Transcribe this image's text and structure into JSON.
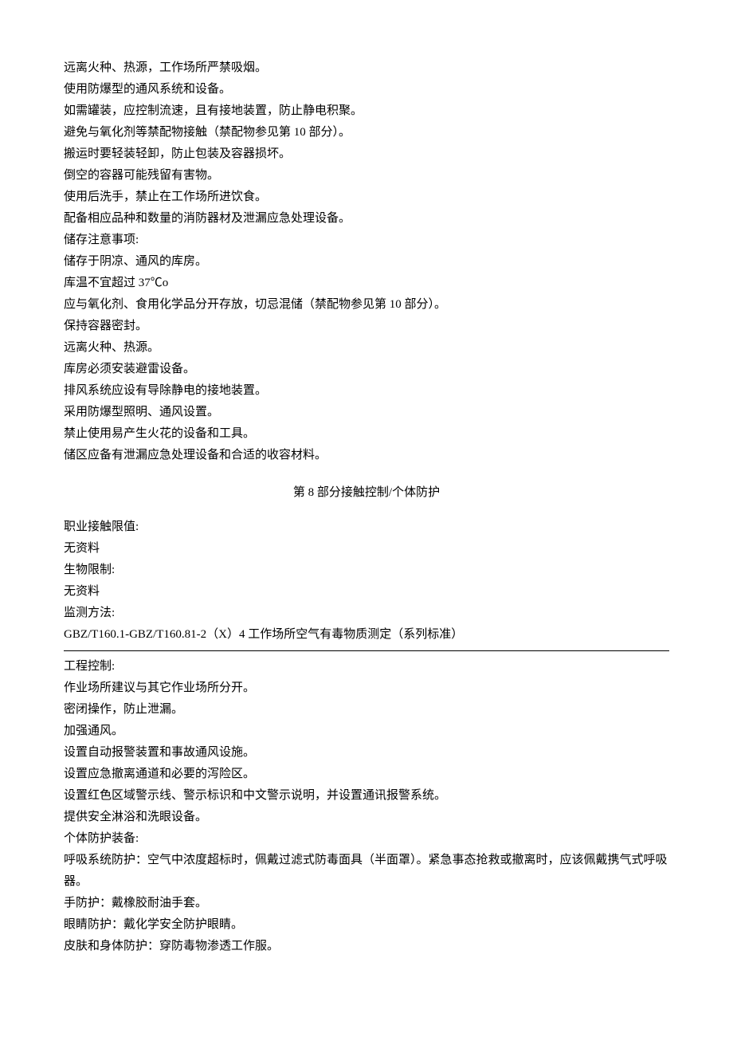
{
  "handling": {
    "lines": [
      "远离火种、热源，工作场所严禁吸烟。",
      "使用防爆型的通风系统和设备。",
      "如需罐装，应控制流速，且有接地装置，防止静电积聚。",
      "避免与氧化剂等禁配物接触（禁配物参见第 10 部分）。",
      "搬运时要轻装轻卸，防止包装及容器损坏。",
      "倒空的容器可能残留有害物。",
      "使用后洗手，禁止在工作场所进饮食。",
      "配备相应品种和数量的消防器材及泄漏应急处理设备。"
    ]
  },
  "storage": {
    "header": "储存注意事项:",
    "lines": [
      "储存于阴凉、通风的库房。",
      "库温不宜超过 37℃o",
      "应与氧化剂、食用化学品分开存放，切忌混储（禁配物参见第 10 部分）。",
      "保持容器密封。",
      "远离火种、热源。",
      "库房必须安装避雷设备。",
      "排风系统应设有导除静电的接地装置。",
      "采用防爆型照明、通风设置。",
      "禁止使用易产生火花的设备和工具。",
      "储区应备有泄漏应急处理设备和合适的收容材料。"
    ]
  },
  "section8": {
    "title": "第 8 部分接触控制/个体防护",
    "occupational_limit_label": "职业接触限值:",
    "occupational_limit_value": "无资料",
    "bio_limit_label": "生物限制:",
    "bio_limit_value": "无资料",
    "monitor_label": "监测方法:",
    "monitor_value": "GBZ/T160.1-GBZ/T160.81-2（X）4 工作场所空气有毒物质测定（系列标准）",
    "eng_control_label": "工程控制:",
    "eng_control_lines": [
      "作业场所建议与其它作业场所分开。",
      "密闭操作，防止泄漏。",
      "加强通风。",
      "设置自动报警装置和事故通风设施。",
      "设置应急撤离通道和必要的泻险区。",
      "设置红色区域警示线、警示标识和中文警示说明，并设置通讯报警系统。",
      "提供安全淋浴和洗眼设备。"
    ],
    "ppe_label": "个体防护装备:",
    "ppe_lines": [
      "呼吸系统防护：空气中浓度超标时，佩戴过滤式防毒面具（半面罩）。紧急事态抢救或撤离时，应该佩戴携气式呼吸器。",
      "手防护：戴橡胶耐油手套。",
      "眼睛防护：戴化学安全防护眼睛。",
      "皮肤和身体防护：穿防毒物渗透工作服。"
    ]
  }
}
